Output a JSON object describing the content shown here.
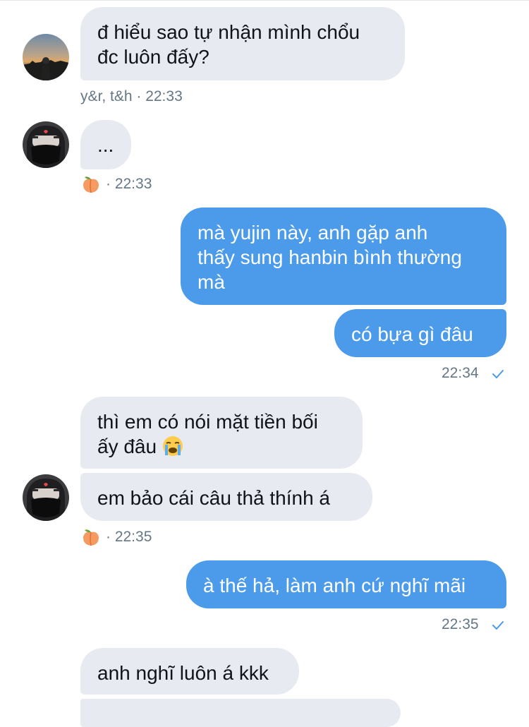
{
  "messages": {
    "m1": {
      "text1": "đ hiểu sao tự nhận mình chổu",
      "text2": "đc luôn đấy?",
      "meta": "y&r, t&h · 22:33"
    },
    "m2": {
      "text": "...",
      "meta": "· 22:33"
    },
    "m3": {
      "text1": "mà yujin này, anh gặp anh",
      "text2": "thấy sung hanbin bình thường",
      "text3": "mà"
    },
    "m4": {
      "text": "có bựa gì đâu",
      "meta": "22:34"
    },
    "m5": {
      "text1": "thì em có nói mặt tiền bối",
      "text2": "ấy đâu"
    },
    "m6": {
      "text": "em bảo cái câu thả thính á",
      "meta": "· 22:35"
    },
    "m7": {
      "text": "à thế hả, làm anh cứ nghĩ mãi",
      "meta": "22:35"
    },
    "m8": {
      "text": "anh nghĩ luôn á kkk"
    }
  },
  "icons": {
    "reaction": "peach-emoji",
    "sent_status": "checkmark-icon",
    "crying_emoji": "loudly-crying-face-emoji"
  },
  "colors": {
    "incoming_bubble": "#e7eaf1",
    "outgoing_bubble": "#4c9bea",
    "meta_text": "#657786",
    "check": "#4c9bea"
  }
}
